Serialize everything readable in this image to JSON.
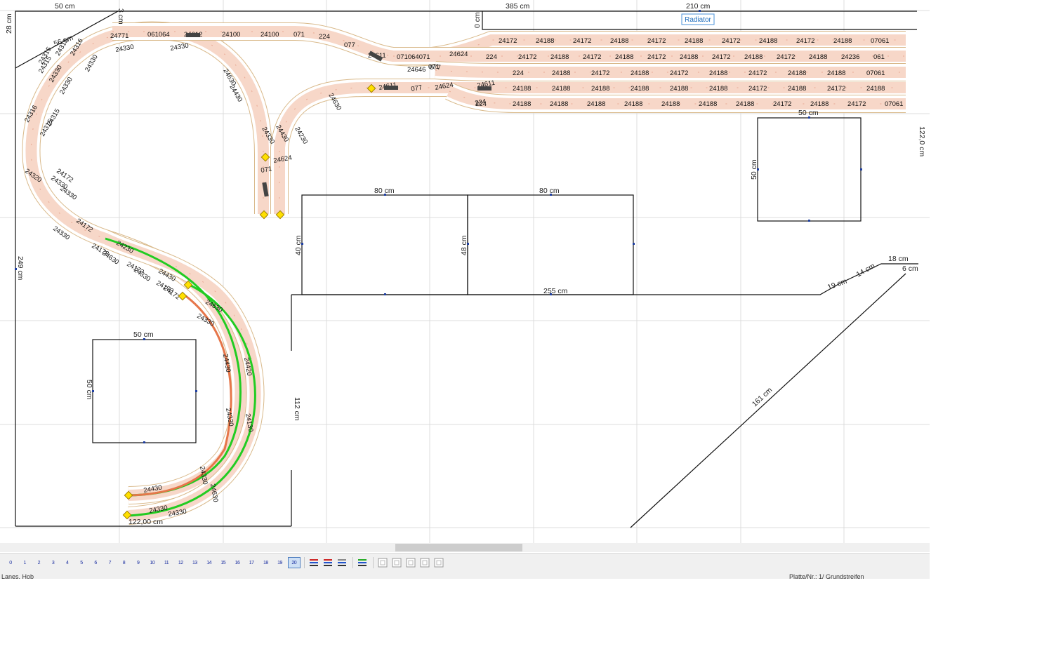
{
  "dimensions": {
    "top_left_width": "50 cm",
    "corner_small": "3 cm",
    "left_top": "28 cm",
    "diag_top": "56 cm",
    "top_total": "385 cm",
    "top_right_width": "210 cm",
    "top_right_zero": "0 cm",
    "left_height": "249 cm",
    "box1_width": "80 cm",
    "box2_width": "80 cm",
    "box1_height": "40 cm",
    "box2_height": "48 cm",
    "bottom_mid": "255 cm",
    "small_box_width": "50 cm",
    "small_box_height": "50 cm",
    "right_box_width": "50 cm",
    "right_box_height": "50 cm",
    "step_19": "19 cm",
    "step_14": "14 cm",
    "step_18": "18 cm",
    "step_6": "6 cm",
    "right_edge": "122,0 cm",
    "diag_161": "161 cm",
    "inner_112": "112 cm",
    "bottom_left": "122,00 cm"
  },
  "radiator_label": "Radiator",
  "track_labels": {
    "yard_row1": [
      "24172",
      "24188",
      "24172",
      "24188",
      "24172",
      "24188",
      "24172",
      "24188",
      "24172",
      "24188",
      "07061"
    ],
    "yard_row2": [
      "224",
      "24172",
      "24188",
      "24172",
      "24188",
      "24172",
      "24188",
      "24172",
      "24188",
      "24172",
      "24188",
      "24236",
      "061"
    ],
    "yard_row3": [
      "224",
      "24188",
      "24172",
      "24188",
      "24172",
      "24188",
      "24172",
      "24188",
      "24188",
      "07061"
    ],
    "yard_row4": [
      "24188",
      "24188",
      "24188",
      "24188",
      "24188",
      "24188",
      "24172",
      "24188",
      "24172",
      "24188",
      "07061"
    ],
    "yard_row5": [
      "224",
      "24188",
      "24188",
      "24188",
      "24188",
      "24188",
      "24188",
      "24188",
      "24172",
      "24188",
      "24172",
      "07061"
    ],
    "top_curve": [
      "24771",
      "061064",
      "24612",
      "24100",
      "24100",
      "071",
      "224",
      "077",
      "24611",
      "071064071",
      "24624",
      "071",
      "24646",
      "077"
    ],
    "mid_curve": [
      "24330",
      "24330",
      "24630",
      "24430",
      "24330",
      "24430",
      "24230",
      "24630",
      "24624",
      "24611",
      "077",
      "24624",
      "24611",
      "224",
      "071"
    ],
    "left_curve": [
      "24315",
      "24315",
      "24316",
      "24315",
      "24330",
      "24330",
      "24330",
      "24316",
      "24315",
      "24315",
      "24320",
      "24330",
      "24330",
      "24172",
      "24172",
      "24330",
      "24630",
      "24330",
      "24172"
    ],
    "lower_curve": [
      "24230",
      "24430",
      "24172",
      "24172",
      "24172",
      "24630",
      "24330",
      "24430",
      "24420",
      "24330",
      "24130",
      "24330",
      "24630",
      "24430",
      "24330",
      "24330"
    ]
  },
  "toolbar": {
    "layers": [
      "0",
      "1",
      "2",
      "3",
      "4",
      "5",
      "6",
      "7",
      "8",
      "9",
      "10",
      "11",
      "12",
      "13",
      "14",
      "15",
      "16",
      "17",
      "18",
      "19",
      "20"
    ],
    "active_layer": "20",
    "icons": [
      "layers-stack-icon",
      "layers-red-icon",
      "layers-gray-icon",
      "layers-color-icon"
    ],
    "view_icons": [
      "view-1-icon",
      "view-2-icon",
      "view-3-icon",
      "view-4-icon",
      "view-5-icon"
    ]
  },
  "status": {
    "left": "Lanes, Hob",
    "right": "Platte/Nr.: 1/ Grundstreifen"
  }
}
